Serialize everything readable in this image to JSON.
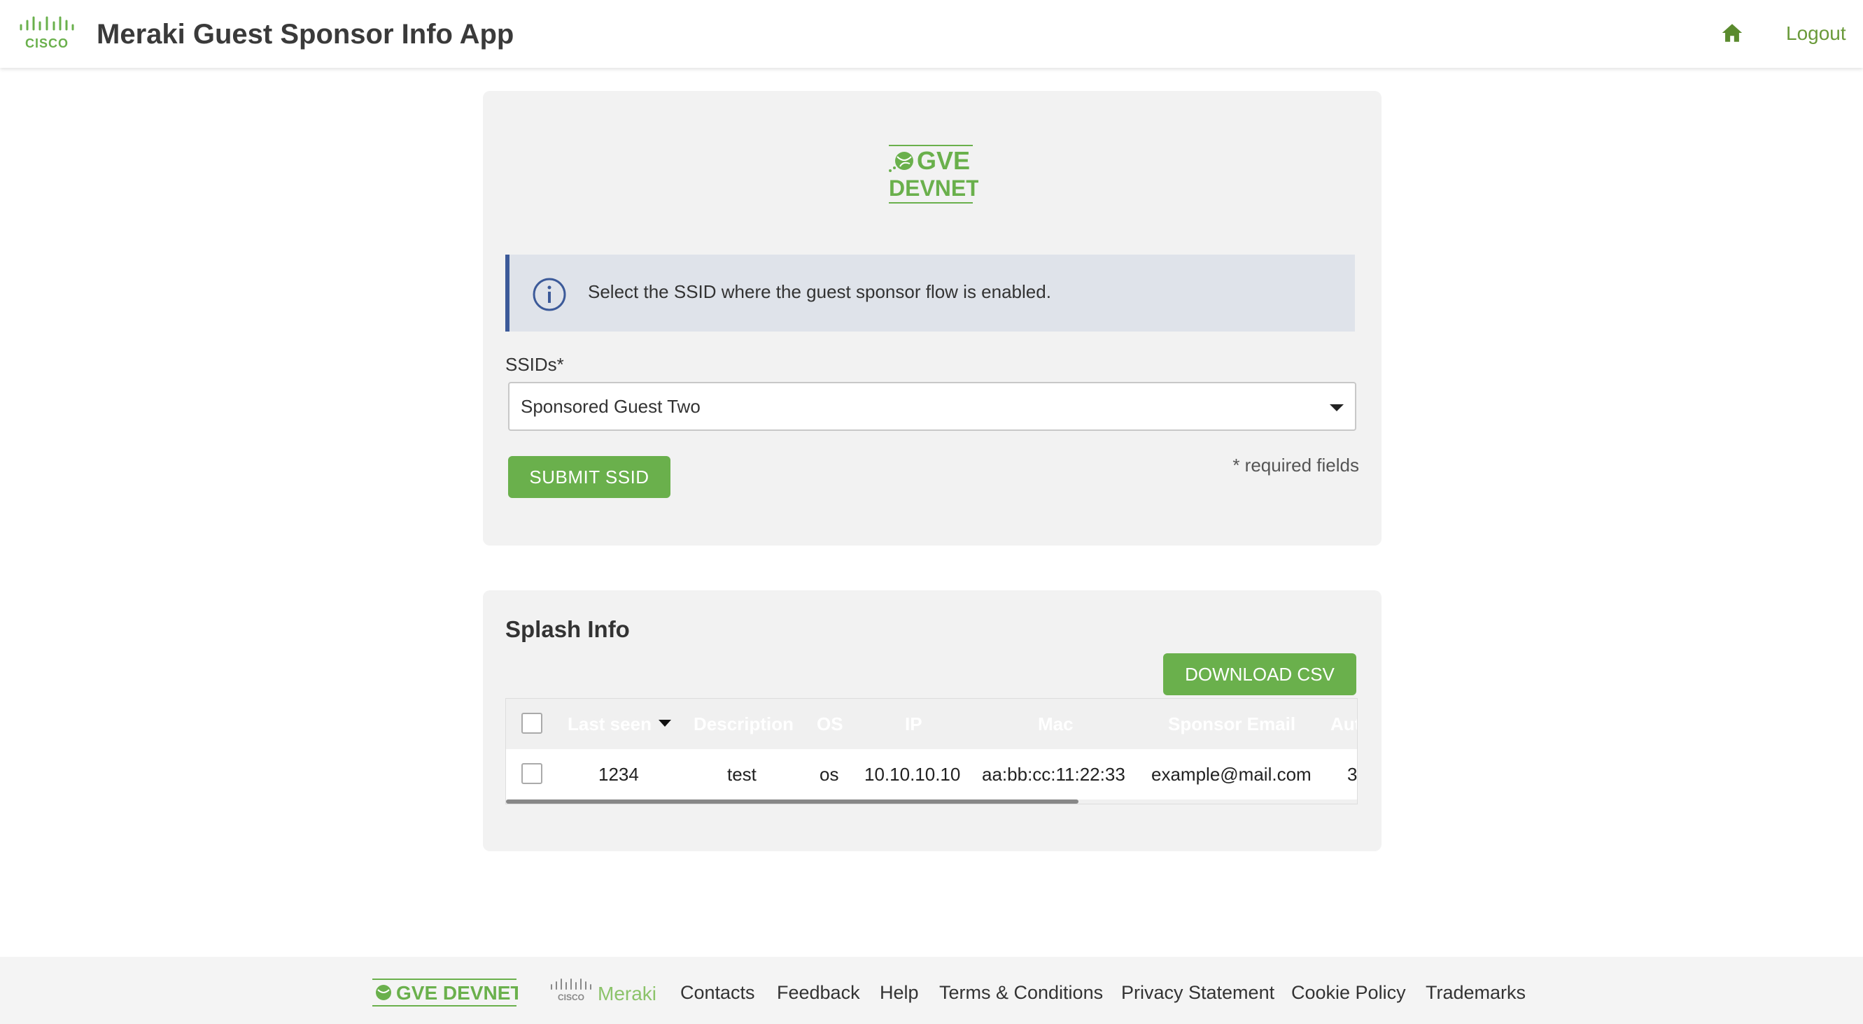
{
  "header": {
    "title": "Meraki Guest Sponsor Info App",
    "logo_text": "CISCO",
    "logout_label": "Logout",
    "home_icon": "home-icon"
  },
  "ssid_panel": {
    "logo_line1": "GVE",
    "logo_line2": "DEVNET",
    "alert_text": "Select the SSID where the guest sponsor flow is enabled.",
    "ssid_label": "SSIDs*",
    "ssid_selected": "Sponsored Guest Two",
    "submit_label": "SUBMIT SSID",
    "required_note": "* required fields"
  },
  "splash": {
    "title": "Splash Info",
    "download_label": "DOWNLOAD CSV",
    "columns": [
      "Last seen",
      "Description",
      "OS",
      "IP",
      "Mac",
      "Sponsor Email",
      "Aut"
    ],
    "rows": [
      [
        "1234",
        "test",
        "os",
        "10.10.10.10",
        "aa:bb:cc:11:22:33",
        "example@mail.com",
        "3"
      ]
    ]
  },
  "footer": {
    "gve_logo": "GVE DEVNET",
    "meraki_logo_cisco": "CISCO",
    "meraki_logo": "Meraki",
    "links": [
      "Contacts",
      "Feedback",
      "Help",
      "Terms & Conditions",
      "Privacy Statement",
      "Cookie Policy",
      "Trademarks"
    ]
  },
  "colors": {
    "accent_green": "#6ab04c",
    "alert_border": "#3c5a99",
    "alert_bg": "#dfe3ea"
  }
}
